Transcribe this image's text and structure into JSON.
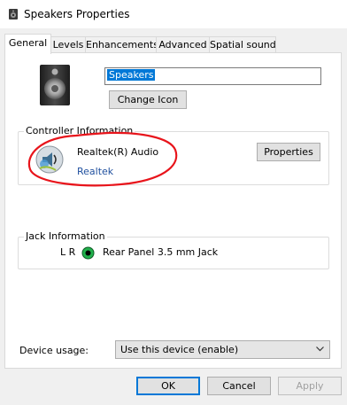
{
  "window": {
    "title": "Speakers Properties",
    "icon": "speaker-icon"
  },
  "tabs": [
    {
      "label": "General",
      "active": true
    },
    {
      "label": "Levels",
      "active": false
    },
    {
      "label": "Enhancements",
      "active": false
    },
    {
      "label": "Advanced",
      "active": false
    },
    {
      "label": "Spatial sound",
      "active": false
    }
  ],
  "device": {
    "icon": "speaker-device-icon",
    "name": "Speakers",
    "change_icon_label": "Change Icon"
  },
  "controller": {
    "group_label": "Controller Information",
    "icon": "audio-controller-icon",
    "name": "Realtek(R) Audio",
    "vendor": "Realtek",
    "properties_label": "Properties",
    "annotation_color": "#e8141b"
  },
  "jack": {
    "group_label": "Jack Information",
    "channels": "L R",
    "jack_color": "#22b14c",
    "description": "Rear Panel 3.5 mm Jack"
  },
  "usage": {
    "label": "Device usage:",
    "selected": "Use this device (enable)"
  },
  "buttons": {
    "ok": "OK",
    "cancel": "Cancel",
    "apply": "Apply",
    "apply_enabled": false
  },
  "colors": {
    "accent": "#0078d7",
    "link": "#1f4f9e"
  }
}
